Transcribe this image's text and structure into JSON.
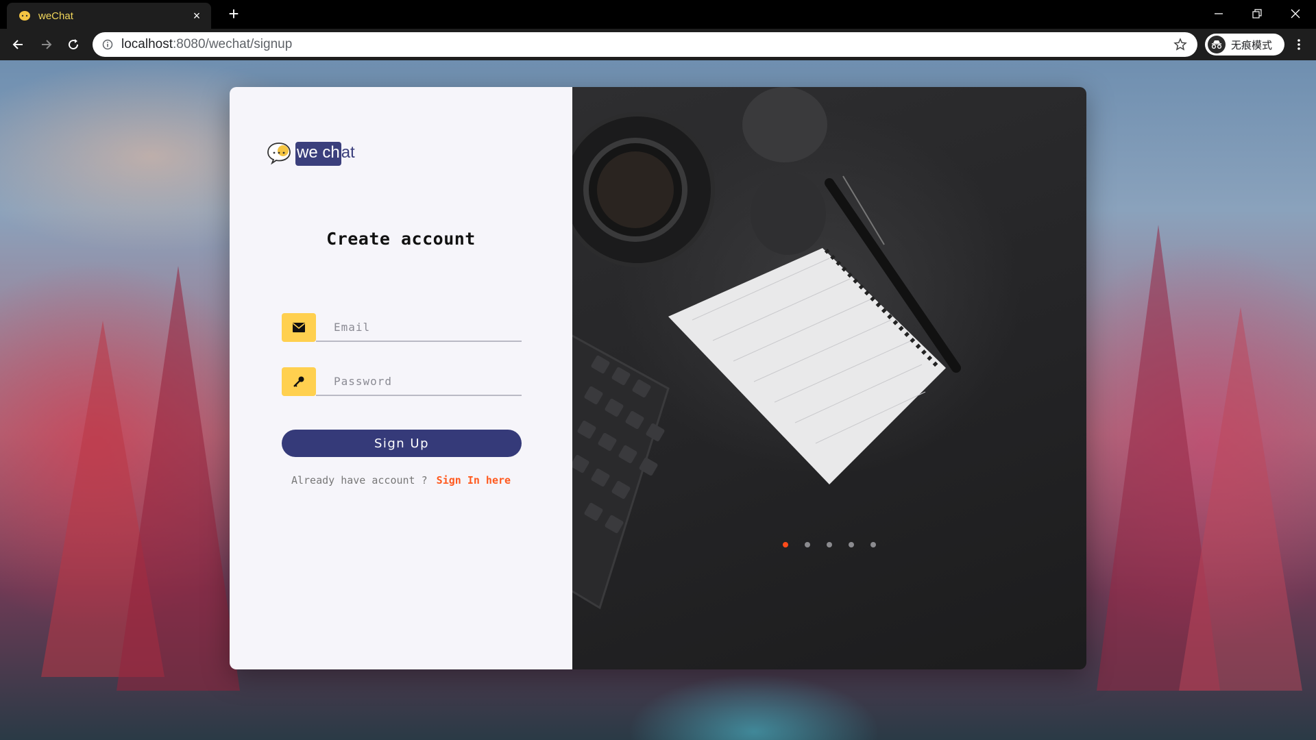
{
  "browser": {
    "tab_title": "weChat",
    "tab_close": "×",
    "new_tab": "+",
    "url_host": "localhost",
    "url_rest": ":8080/wechat/signup",
    "incognito_label": "无痕模式"
  },
  "app": {
    "logo_text_highlight": "we ch",
    "logo_text_rest": "at",
    "heading": "Create account",
    "email_placeholder": "Email",
    "password_placeholder": "Password",
    "signup_label": "Sign Up",
    "signin_prompt": "Already have account ?",
    "signin_link": "Sign In here"
  },
  "carousel": {
    "slide_count": 5,
    "active_index": 0
  },
  "colors": {
    "primary": "#353a79",
    "accent": "#ffd04f",
    "link": "#ff5a1f",
    "tab_title": "#f2d75b"
  },
  "icons": [
    "wechat-logo-icon",
    "mail-icon",
    "key-icon",
    "back-arrow-icon",
    "forward-arrow-icon",
    "reload-icon",
    "info-icon",
    "star-icon",
    "incognito-icon",
    "menu-icon"
  ]
}
